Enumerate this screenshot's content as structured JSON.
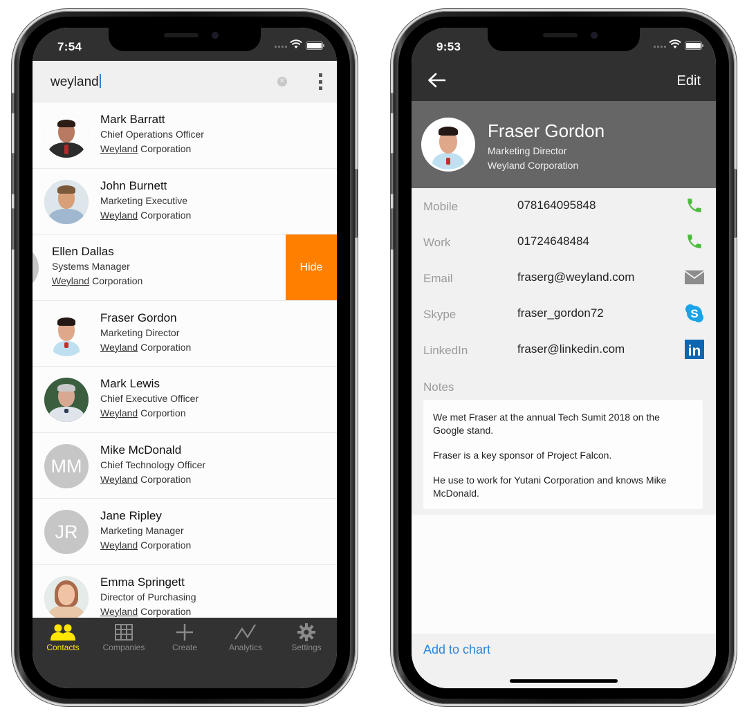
{
  "left_phone": {
    "status_bar": {
      "time": "7:54"
    },
    "search": {
      "query": "weyland",
      "clear_icon": "clear-circle-icon",
      "more_icon": "vertical-ellipsis-icon"
    },
    "contacts": [
      {
        "name": "Mark Barratt",
        "title": "Chief Operations Officer",
        "company_match": "Weyland",
        "company_rest": " Corporation",
        "avatar_type": "photo",
        "photo": "man-suit-red-tie"
      },
      {
        "name": "John Burnett",
        "title": "Marketing Executive",
        "company_match": "Weyland",
        "company_rest": " Corporation",
        "avatar_type": "photo",
        "photo": "man-smiling-beard"
      },
      {
        "name": "Ellen Dallas",
        "title": "Systems Manager",
        "company_match": "Weyland",
        "company_rest": " Corporation",
        "avatar_type": "initials",
        "swiped": true,
        "action_label": "Hide"
      },
      {
        "name": "Fraser Gordon",
        "title": "Marketing Director",
        "company_match": "Weyland",
        "company_rest": " Corporation",
        "avatar_type": "photo",
        "photo": "man-smiling-blue-shirt"
      },
      {
        "name": "Mark Lewis",
        "title": "Chief Executive Officer",
        "company_match": "Weyland",
        "company_rest": " Corportion",
        "avatar_type": "photo",
        "photo": "older-man-grey-hair"
      },
      {
        "name": "Mike McDonald",
        "title": "Chief Technology Officer",
        "company_match": "Weyland",
        "company_rest": " Corporation",
        "avatar_type": "initials",
        "initials": "MM"
      },
      {
        "name": "Jane Ripley",
        "title": "Marketing Manager",
        "company_match": "Weyland",
        "company_rest": " Corporation",
        "avatar_type": "initials",
        "initials": "JR"
      },
      {
        "name": "Emma Springett",
        "title": "Director of Purchasing",
        "company_match": "Weyland",
        "company_rest": " Corporation",
        "avatar_type": "photo",
        "photo": "woman-long-hair"
      }
    ],
    "tabs": [
      {
        "label": "Contacts",
        "icon": "contacts-icon",
        "active": true
      },
      {
        "label": "Companies",
        "icon": "building-icon",
        "active": false
      },
      {
        "label": "Create",
        "icon": "plus-icon",
        "active": false
      },
      {
        "label": "Analytics",
        "icon": "line-chart-icon",
        "active": false
      },
      {
        "label": "Settings",
        "icon": "gear-icon",
        "active": false
      }
    ],
    "colors": {
      "accent_active_tab": "#ffe600",
      "hide_action": "#ff8000",
      "tabbar_bg": "#323232"
    }
  },
  "right_phone": {
    "status_bar": {
      "time": "9:53"
    },
    "nav": {
      "back_icon": "arrow-left-icon",
      "edit_label": "Edit"
    },
    "profile": {
      "name": "Fraser Gordon",
      "title": "Marketing Director",
      "company": "Weyland Corporation"
    },
    "fields": [
      {
        "label": "Mobile",
        "value": "078164095848",
        "icon": "phone-icon"
      },
      {
        "label": "Work",
        "value": "01724648484",
        "icon": "phone-icon"
      },
      {
        "label": "Email",
        "value": "fraserg@weyland.com",
        "icon": "mail-icon"
      },
      {
        "label": "Skype",
        "value": "fraser_gordon72",
        "icon": "skype-icon"
      },
      {
        "label": "LinkedIn",
        "value": "fraser@linkedin.com",
        "icon": "linkedin-icon"
      }
    ],
    "notes": {
      "label": "Notes",
      "paragraphs": [
        "We met Fraser at the annual Tech Sumit 2018 on the Google stand.",
        "Fraser is a key sponsor of Project Falcon.",
        "He use to work for Yutani Corporation and knows Mike McDonald."
      ]
    },
    "footer": {
      "add_label": "Add to chart"
    },
    "colors": {
      "phone_icon": "#4cbb3c",
      "skype": "#1aa3e8",
      "linkedin": "#0e66b2",
      "link": "#2d86d8",
      "profile_bg": "#666666"
    }
  }
}
